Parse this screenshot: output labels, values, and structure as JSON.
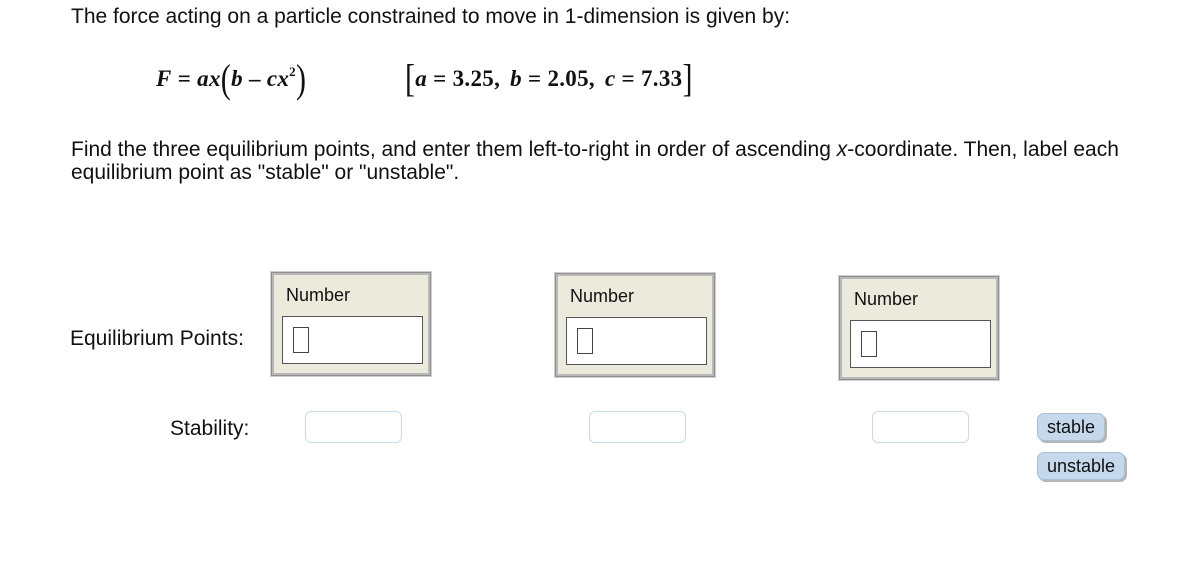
{
  "question": {
    "intro": "The force acting on a particle constrained to move in 1-dimension is given by:",
    "instruction_before_x": "Find the three equilibrium points, and enter them left-to-right in order of ascending ",
    "instruction_x": "x",
    "instruction_after_x": "-coordinate. Then, label each equilibrium point as \"stable\" or \"unstable\"."
  },
  "formula": {
    "lhs": "F",
    "eq": " = ",
    "a": "a",
    "x": "x",
    "open": "(",
    "b": "b",
    "minus": " – ",
    "c": "c",
    "x2": "x",
    "exp": "2",
    "close": ")"
  },
  "params": {
    "open": "[",
    "a_name": "a",
    "a_val": " = 3.25,",
    "b_name": "b",
    "b_val": " = 2.05,",
    "c_name": "c",
    "c_val": " = 7.33",
    "close": "]"
  },
  "labels": {
    "equilibrium": "Equilibrium Points:",
    "stability": "Stability:"
  },
  "number_fields": [
    {
      "title": "Number",
      "value": ""
    },
    {
      "title": "Number",
      "value": ""
    },
    {
      "title": "Number",
      "value": ""
    }
  ],
  "stability_slots": [
    "",
    "",
    ""
  ],
  "options": [
    "stable",
    "unstable"
  ]
}
